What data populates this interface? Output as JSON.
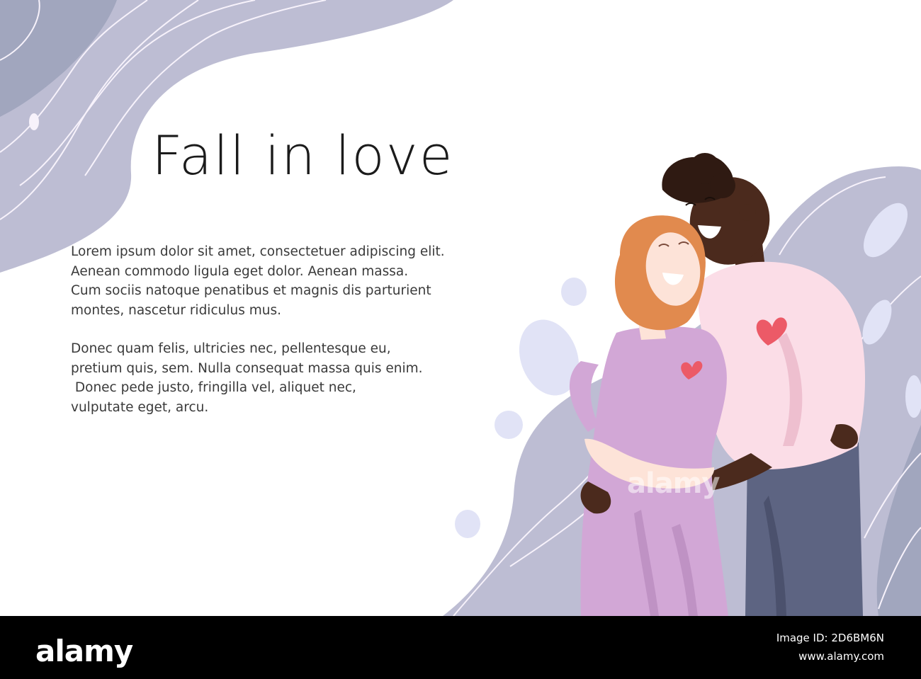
{
  "headline": "Fall in love",
  "body_paragraphs": [
    {
      "lines": [
        "Lorem ipsum dolor sit amet, consectetuer adipiscing elit.",
        "Aenean commodo ligula eget dolor. Aenean massa.",
        "Cum sociis natoque penatibus et magnis dis parturient",
        "montes, nascetur ridiculus mus."
      ]
    },
    {
      "lines": [
        "Donec quam felis, ultricies nec, pellentesque eu,",
        "pretium quis, sem. Nulla consequat massa quis enim.",
        " Donec pede justo, fringilla vel, aliquet nec,",
        "vulputate eget, arcu."
      ]
    }
  ],
  "watermark": "alamy",
  "footer": {
    "logo": "alamy",
    "image_id": "Image ID: 2D6BM6N",
    "site": "www.alamy.com"
  },
  "palette": {
    "blob_dark": "#a1a6be",
    "blob_light": "#bdbdd3",
    "accent_light": "#e1e3f6",
    "line": "#f7f2fb",
    "dress": "#d2a7d6",
    "sweater": "#fbdde7",
    "jeans": "#5d6482",
    "skin_light": "#fde3d8",
    "skin_dark": "#4b2a1d",
    "hair_red": "#e18a4e",
    "hair_dark": "#2f1a12",
    "heart": "#ec5a67"
  },
  "icons": [
    "heart-icon"
  ]
}
